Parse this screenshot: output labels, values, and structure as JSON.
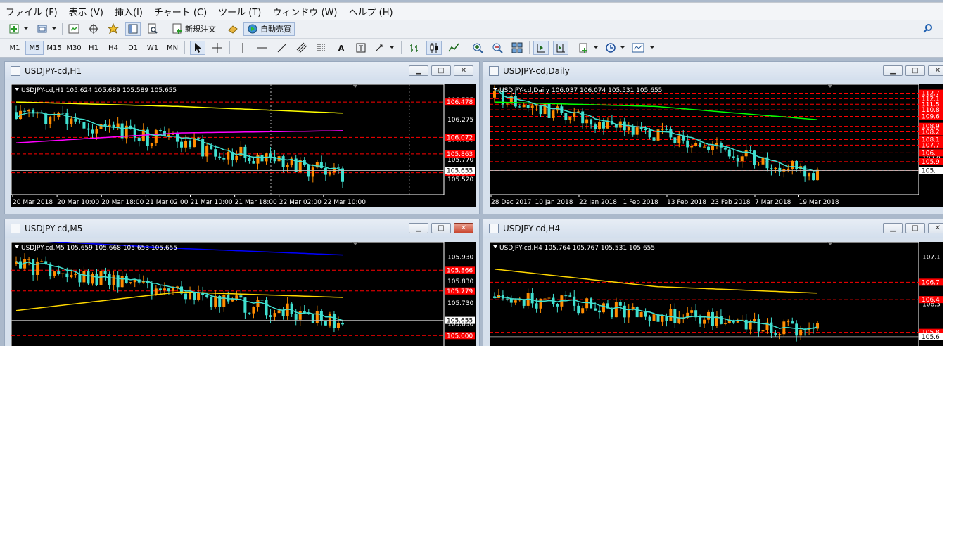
{
  "menu": [
    "ファイル (F)",
    "表示 (V)",
    "挿入(I)",
    "チャート (C)",
    "ツール (T)",
    "ウィンドウ (W)",
    "ヘルプ (H)"
  ],
  "toolbar": {
    "new_order_label": "新規注文",
    "auto_trade_label": "自動売買",
    "timeframes": [
      "M1",
      "M5",
      "M15",
      "M30",
      "H1",
      "H4",
      "D1",
      "W1",
      "MN"
    ],
    "active_timeframe": "M5",
    "text_tool_label": "A"
  },
  "windows": [
    {
      "title": "USDJPY-cd,H1",
      "info": "USDJPY-cd,H1  105.624 105.689 105.589 105.655",
      "yticks": [
        "106.525",
        "106.275",
        "106.020",
        "105.770",
        "105.520"
      ],
      "level_labels": [
        "106.478",
        "106.072",
        "105.863",
        "105.650"
      ],
      "current_label": "105.655",
      "xlabels": [
        "20 Mar 2018",
        "20 Mar 10:00",
        "20 Mar 18:00",
        "21 Mar 02:00",
        "21 Mar 10:00",
        "21 Mar 18:00",
        "22 Mar 02:00",
        "22 Mar 10:00"
      ],
      "ma_colors": [
        "#ffff00",
        "#ff00ff",
        "#40e0d0"
      ]
    },
    {
      "title": "USDJPY-cd,Daily",
      "info": "USDJPY-cd,Daily  106.037 106.074 105.531 105.655",
      "yticks": [
        "107.0"
      ],
      "level_labels": [
        "112.7",
        "112.1",
        "111.5",
        "110.8",
        "109.6",
        "108.9",
        "108.2",
        "108.1",
        "107.7",
        "106.",
        "105.9"
      ],
      "current_label": "105.",
      "xlabels": [
        "28 Dec 2017",
        "10 Jan 2018",
        "22 Jan 2018",
        "1 Feb 2018",
        "13 Feb 2018",
        "23 Feb 2018",
        "7 Mar 2018",
        "19 Mar 2018"
      ],
      "ma_colors": [
        "#00ff00",
        "#40e0d0"
      ]
    },
    {
      "title": "USDJPY-cd,M5",
      "info": "USDJPY-cd,M5  105.659 105.668 105.653 105.655",
      "yticks": [
        "105.930",
        "105.830",
        "105.730",
        "105.630"
      ],
      "level_labels": [
        "105.866",
        "105.779",
        "105.600"
      ],
      "current_label": "105.655",
      "xlabels": [],
      "ma_colors": [
        "#0000ff",
        "#ffd700",
        "#40e0d0"
      ]
    },
    {
      "title": "USDJPY-cd,H4",
      "info": "USDJPY-cd,H4  105.764 105.767 105.531 105.655",
      "yticks": [
        "107.1",
        "106.3"
      ],
      "level_labels": [
        "106.7",
        "106.4",
        "105.8"
      ],
      "current_label": "105.6",
      "xlabels": [],
      "ma_colors": [
        "#ffd700",
        "#40e0d0"
      ]
    }
  ],
  "colors": {
    "bull": "#ff8c00",
    "bear": "#40e0d0",
    "level_line": "#ff0000",
    "level_label_bg": "#ff0000",
    "chart_bg": "#000000"
  }
}
